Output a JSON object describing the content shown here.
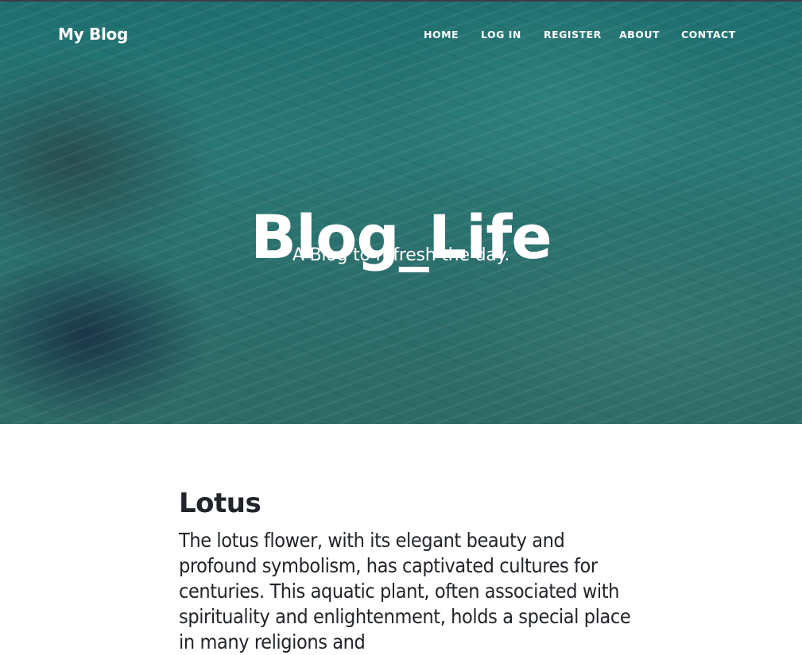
{
  "header": {
    "brand": "My Blog",
    "nav": [
      "HOME",
      "LOG IN",
      "REGISTER",
      "ABOUT",
      "CONTACT"
    ]
  },
  "hero": {
    "title": "Blog_Life",
    "subtitle": "A Blog to refresh the day."
  },
  "post": {
    "title": "Lotus",
    "body": "The lotus flower, with its elegant beauty and profound symbolism, has captivated cultures for centuries. This aquatic plant, often associated with spirituality and enlightenment, holds a special place in many religions and"
  }
}
